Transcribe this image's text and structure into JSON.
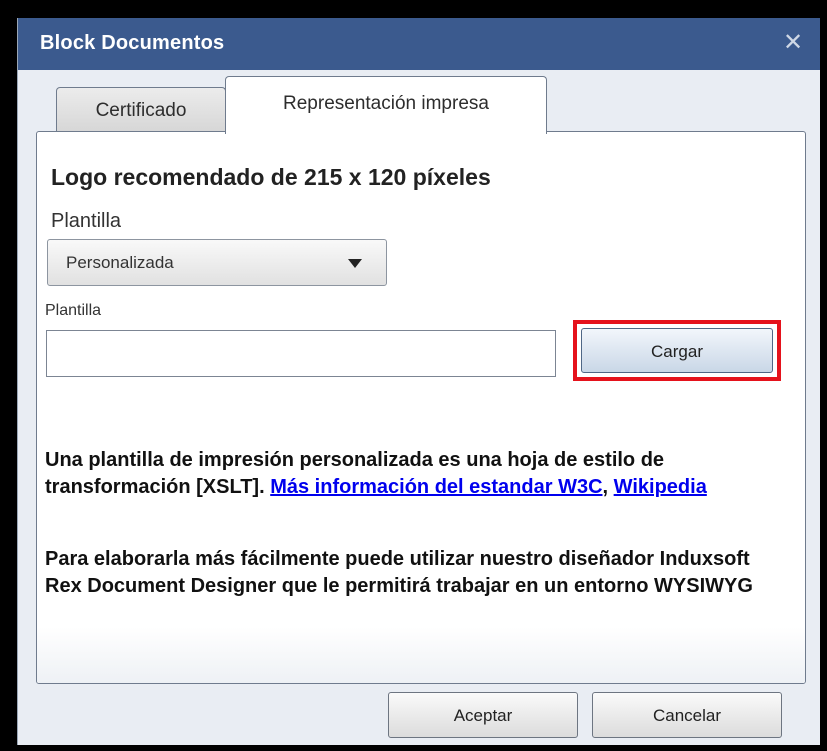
{
  "window": {
    "title": "Block Documentos",
    "close_symbol": "✕"
  },
  "tabs": [
    {
      "label": "Certificado",
      "active": false
    },
    {
      "label": "Representación impresa",
      "active": true
    }
  ],
  "panel": {
    "heading": "Logo recomendado de 215 x 120 píxeles",
    "template_label": "Plantilla",
    "template_select": {
      "value": "Personalizada"
    },
    "file_label": "Plantilla",
    "file_input": {
      "value": "",
      "placeholder": ""
    },
    "load_button": "Cargar",
    "info_paragraph": {
      "text_1": "Una plantilla de impresión personalizada es una hoja de estilo de transformación [XSLT]. ",
      "link_1": "Más información del estandar W3C",
      "sep": ", ",
      "link_2": "Wikipedia"
    },
    "designer_paragraph": "Para elaborarla más fácilmente puede utilizar nuestro diseñador Induxsoft Rex Document Designer que le permitirá trabajar en un entorno WYSIWYG"
  },
  "footer": {
    "accept_button": "Aceptar",
    "cancel_button": "Cancelar"
  },
  "colors": {
    "titlebar": "#3b5a8e",
    "highlight": "#e5121c",
    "link": "#0000ee"
  }
}
